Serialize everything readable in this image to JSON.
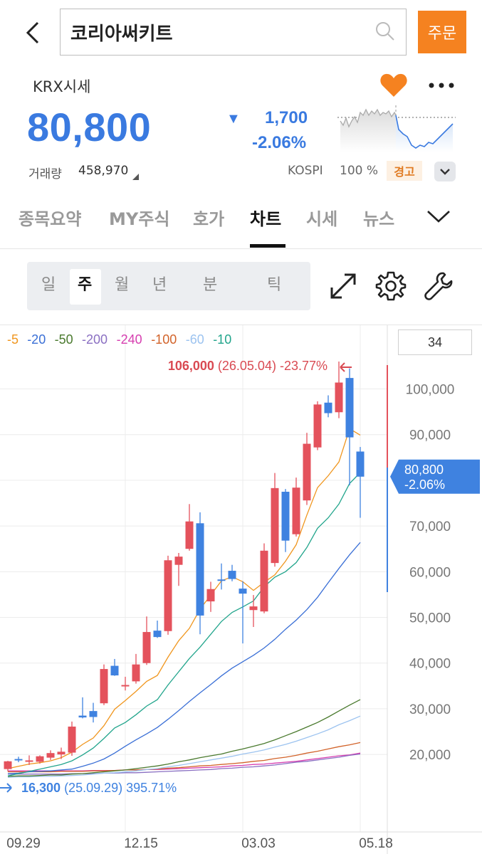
{
  "header": {
    "stock_name": "코리아써키트",
    "order_label": "주문"
  },
  "quote": {
    "market_label": "KRX시세",
    "price": "80,800",
    "change_amount": "1,700",
    "change_percent": "-2.06%",
    "volume_label": "거래량",
    "volume_value": "458,970",
    "index_label": "KOSPI",
    "margin_label": "100 %",
    "warning_badge": "경고",
    "price_color": "#3a7ae0",
    "favorite_color": "#f58220"
  },
  "tabs": [
    {
      "label": "종목요약"
    },
    {
      "label": "MY주식"
    },
    {
      "label": "호가"
    },
    {
      "label": "차트",
      "active": true
    },
    {
      "label": "시세"
    },
    {
      "label": "뉴스"
    }
  ],
  "periods": [
    {
      "label": "일"
    },
    {
      "label": "주",
      "active": true
    },
    {
      "label": "월"
    },
    {
      "label": "년"
    },
    {
      "label": "분"
    },
    {
      "label": "틱"
    }
  ],
  "icons": {
    "back": "chevron-left-icon",
    "search": "search-icon",
    "favorite": "heart-icon",
    "more": "more-dots-icon",
    "tab_more": "chevron-down-icon",
    "fullscreen": "expand-arrows-icon",
    "settings": "gear-icon",
    "tools": "wrench-icon"
  },
  "chart": {
    "candle_count": "34",
    "high_annotation": {
      "price": "106,000",
      "detail": "(26.05.04) -23.77%"
    },
    "low_annotation": {
      "price": "16,300",
      "detail": "(25.09.29) 395.71%"
    },
    "current_label_price": "80,800",
    "current_label_pct": "-2.06%",
    "up_color": "#e4525c",
    "down_color": "#3f82e0"
  },
  "chart_data": {
    "type": "candlestick",
    "ylim": [
      13000,
      113000
    ],
    "y_ticks": [
      20000,
      30000,
      40000,
      50000,
      60000,
      70000,
      80000,
      90000,
      100000
    ],
    "y_tick_labels": [
      "20,000",
      "30,000",
      "40,000",
      "50,000",
      "60,000",
      "70,000",
      "80,000",
      "90,000",
      "100,000"
    ],
    "x_tick_labels": [
      {
        "label": "09.29",
        "index": 1
      },
      {
        "label": "12.15",
        "index": 12
      },
      {
        "label": "03.03",
        "index": 23
      },
      {
        "label": "05.18",
        "index": 34
      }
    ],
    "moving_average_legend": [
      {
        "name": "5",
        "color": "#f0961e"
      },
      {
        "name": "20",
        "color": "#3a6fd6"
      },
      {
        "name": "50",
        "color": "#4a7a2e"
      },
      {
        "name": "200",
        "color": "#8a6fc2"
      },
      {
        "name": "240",
        "color": "#d63fb0"
      },
      {
        "name": "100",
        "color": "#d2632a"
      },
      {
        "name": "60",
        "color": "#9cc3f0"
      },
      {
        "name": "10",
        "color": "#22a58c"
      }
    ],
    "candles": [
      {
        "o": 16800,
        "h": 18600,
        "l": 16300,
        "c": 18500
      },
      {
        "o": 19000,
        "h": 19500,
        "l": 18300,
        "c": 18900
      },
      {
        "o": 18600,
        "h": 19800,
        "l": 17700,
        "c": 18700
      },
      {
        "o": 18400,
        "h": 19800,
        "l": 18000,
        "c": 19600
      },
      {
        "o": 19300,
        "h": 20900,
        "l": 18800,
        "c": 20300
      },
      {
        "o": 20000,
        "h": 21500,
        "l": 19000,
        "c": 20600
      },
      {
        "o": 20400,
        "h": 27200,
        "l": 19700,
        "c": 26100
      },
      {
        "o": 28500,
        "h": 32500,
        "l": 27900,
        "c": 28100
      },
      {
        "o": 29500,
        "h": 31300,
        "l": 27000,
        "c": 28200
      },
      {
        "o": 31200,
        "h": 39700,
        "l": 30800,
        "c": 38700
      },
      {
        "o": 39400,
        "h": 40900,
        "l": 37200,
        "c": 37300
      },
      {
        "o": 35200,
        "h": 37000,
        "l": 34000,
        "c": 35200
      },
      {
        "o": 36000,
        "h": 42000,
        "l": 35500,
        "c": 39700
      },
      {
        "o": 40000,
        "h": 50200,
        "l": 39600,
        "c": 46800
      },
      {
        "o": 47100,
        "h": 49300,
        "l": 45500,
        "c": 45700
      },
      {
        "o": 47000,
        "h": 63500,
        "l": 46200,
        "c": 62500
      },
      {
        "o": 61500,
        "h": 64100,
        "l": 56900,
        "c": 63300
      },
      {
        "o": 65000,
        "h": 74800,
        "l": 64600,
        "c": 71000
      },
      {
        "o": 70600,
        "h": 73000,
        "l": 46300,
        "c": 50400
      },
      {
        "o": 53500,
        "h": 57800,
        "l": 51200,
        "c": 56200
      },
      {
        "o": 58300,
        "h": 61800,
        "l": 56100,
        "c": 58000
      },
      {
        "o": 60200,
        "h": 61500,
        "l": 57900,
        "c": 58400
      },
      {
        "o": 56300,
        "h": 57900,
        "l": 44300,
        "c": 55200
      },
      {
        "o": 51600,
        "h": 54900,
        "l": 47900,
        "c": 52400
      },
      {
        "o": 51300,
        "h": 66200,
        "l": 50900,
        "c": 64600
      },
      {
        "o": 61900,
        "h": 81600,
        "l": 61100,
        "c": 78300
      },
      {
        "o": 77500,
        "h": 78100,
        "l": 64300,
        "c": 66800
      },
      {
        "o": 68200,
        "h": 80600,
        "l": 67700,
        "c": 78400
      },
      {
        "o": 75600,
        "h": 90400,
        "l": 74600,
        "c": 88000
      },
      {
        "o": 87200,
        "h": 97300,
        "l": 86600,
        "c": 96600
      },
      {
        "o": 97000,
        "h": 98600,
        "l": 93800,
        "c": 94700
      },
      {
        "o": 94900,
        "h": 106000,
        "l": 93600,
        "c": 101400
      },
      {
        "o": 102400,
        "h": 104500,
        "l": 78900,
        "c": 89400
      },
      {
        "o": 86300,
        "h": 87300,
        "l": 71800,
        "c": 80800
      }
    ],
    "moving_averages": {
      "5": [
        16900,
        17400,
        17900,
        18200,
        18600,
        19300,
        20500,
        22200,
        23600,
        26300,
        29900,
        31800,
        33800,
        36000,
        37300,
        41300,
        44900,
        47600,
        51800,
        54900,
        58000,
        58900,
        57800,
        55900,
        57700,
        59300,
        62300,
        65900,
        72400,
        78400,
        81000,
        84000,
        91300,
        89900
      ],
      "10": [
        15300,
        15800,
        16300,
        16800,
        17300,
        17800,
        18600,
        19900,
        21400,
        23500,
        25800,
        27000,
        28700,
        30600,
        32000,
        35200,
        38100,
        41000,
        43500,
        46300,
        49100,
        51100,
        52300,
        53600,
        56700,
        58800,
        60000,
        62000,
        65300,
        69500,
        71800,
        74800,
        79300,
        81700
      ],
      "20": [
        15800,
        15900,
        16200,
        16300,
        16400,
        16600,
        16800,
        17400,
        18100,
        19000,
        20300,
        21800,
        23200,
        24500,
        25900,
        27700,
        29600,
        31600,
        33500,
        35300,
        37200,
        38900,
        40300,
        41700,
        43300,
        45200,
        47400,
        49400,
        51700,
        54400,
        57600,
        60700,
        63700,
        66400
      ],
      "50": [
        15200,
        15300,
        15300,
        15400,
        15500,
        15500,
        15700,
        15800,
        16000,
        16200,
        16400,
        16600,
        16900,
        17200,
        17500,
        17900,
        18400,
        18800,
        19300,
        19700,
        20100,
        20700,
        21200,
        21800,
        22400,
        23200,
        24100,
        25000,
        26000,
        27000,
        28200,
        29500,
        30800,
        32000
      ],
      "60": [
        15000,
        15100,
        15100,
        15200,
        15200,
        15300,
        15400,
        15500,
        15700,
        15900,
        16000,
        16200,
        16400,
        16700,
        16900,
        17300,
        17600,
        18000,
        18400,
        18800,
        19200,
        19600,
        20100,
        20500,
        21000,
        21600,
        22200,
        22900,
        23700,
        24500,
        25400,
        26500,
        27400,
        28400
      ],
      "100": [
        16200,
        16200,
        16200,
        16200,
        16200,
        16300,
        16300,
        16300,
        16400,
        16400,
        16500,
        16600,
        16600,
        16700,
        16800,
        17000,
        17100,
        17300,
        17500,
        17600,
        17800,
        18000,
        18200,
        18500,
        18700,
        19100,
        19400,
        19800,
        20300,
        20700,
        21200,
        21700,
        22100,
        22600
      ],
      "200": [
        15700,
        15700,
        15700,
        15700,
        15700,
        15700,
        15800,
        15800,
        15800,
        15900,
        15900,
        16000,
        16000,
        16100,
        16200,
        16300,
        16400,
        16500,
        16600,
        16700,
        16900,
        17000,
        17200,
        17300,
        17500,
        17700,
        18000,
        18300,
        18500,
        18800,
        19100,
        19400,
        19800,
        20100
      ],
      "240": [
        16400,
        16400,
        16400,
        16400,
        16400,
        16400,
        16400,
        16400,
        16500,
        16500,
        16500,
        16600,
        16600,
        16700,
        16700,
        16800,
        16900,
        17000,
        17100,
        17200,
        17300,
        17500,
        17600,
        17800,
        17900,
        18100,
        18300,
        18500,
        18800,
        19100,
        19400,
        19700,
        19900,
        20300
      ]
    }
  }
}
